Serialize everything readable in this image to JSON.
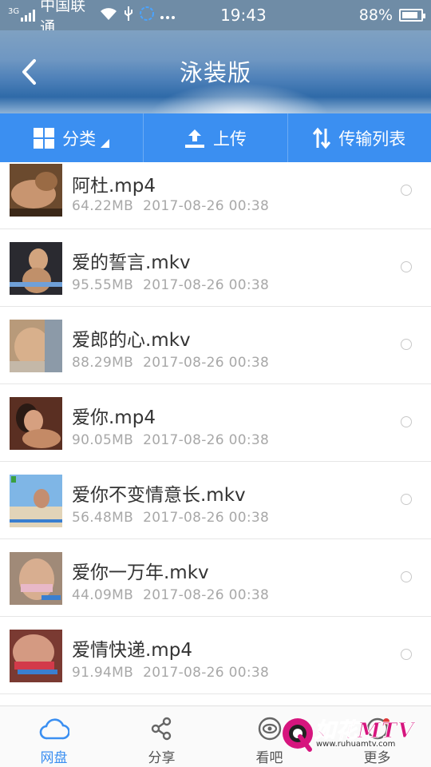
{
  "status_bar": {
    "network_badge": "3G",
    "carrier": "中国联通",
    "time": "19:43",
    "battery": "88%",
    "battery_level": 0.88
  },
  "header": {
    "title": "泳装版",
    "back_icon": "chevron-left-icon"
  },
  "toolbar": {
    "category_label": "分类",
    "upload_label": "上传",
    "transfer_label": "传输列表"
  },
  "files": [
    {
      "name": "阿杜.mp4",
      "size": "64.22MB",
      "date": "2017-08-26 00:38"
    },
    {
      "name": "爱的誓言.mkv",
      "size": "95.55MB",
      "date": "2017-08-26 00:38"
    },
    {
      "name": "爱郎的心.mkv",
      "size": "88.29MB",
      "date": "2017-08-26 00:38"
    },
    {
      "name": "爱你.mp4",
      "size": "90.05MB",
      "date": "2017-08-26 00:38"
    },
    {
      "name": "爱你不变情意长.mkv",
      "size": "56.48MB",
      "date": "2017-08-26 00:38"
    },
    {
      "name": "爱你一万年.mkv",
      "size": "44.09MB",
      "date": "2017-08-26 00:38"
    },
    {
      "name": "爱情快递.mp4",
      "size": "91.94MB",
      "date": "2017-08-26 00:38"
    }
  ],
  "tabs": [
    {
      "label": "网盘",
      "icon": "cloud-icon",
      "active": true
    },
    {
      "label": "分享",
      "icon": "share-icon",
      "active": false
    },
    {
      "label": "看吧",
      "icon": "eye-icon",
      "active": false
    },
    {
      "label": "更多",
      "icon": "more-icon",
      "active": false
    }
  ],
  "watermark": {
    "brand": "如花MTV",
    "url": "www.ruhuamtv.com"
  },
  "colors": {
    "accent": "#3b8ff1",
    "toolbar_bg": "#3b8ff1",
    "text_primary": "#333333",
    "text_secondary": "#a8a8a8"
  }
}
